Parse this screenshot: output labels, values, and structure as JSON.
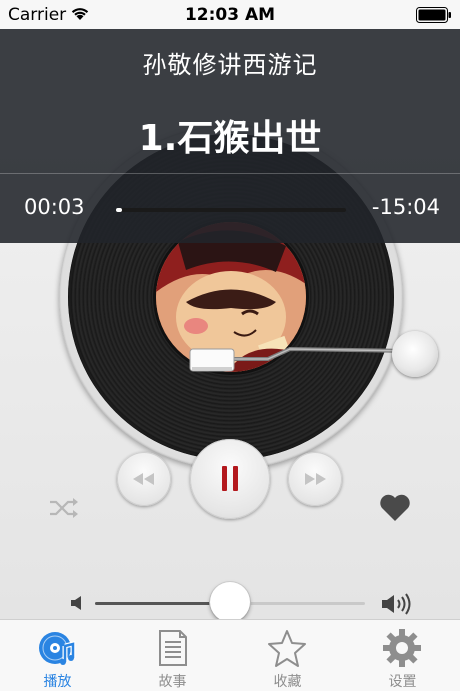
{
  "status_bar": {
    "carrier": "Carrier",
    "time": "12:03 AM"
  },
  "now_playing": {
    "album_title": "孙敬修讲西游记",
    "track_title": "1.石猴出世",
    "elapsed": "00:03",
    "remaining": "-15:04",
    "progress_fraction": 0.01
  },
  "volume": {
    "level_fraction": 0.5
  },
  "tabs": [
    {
      "label": "播放",
      "icon": "play-disc-icon",
      "active": true
    },
    {
      "label": "故事",
      "icon": "document-list-icon",
      "active": false
    },
    {
      "label": "收藏",
      "icon": "star-icon",
      "active": false
    },
    {
      "label": "设置",
      "icon": "gear-icon",
      "active": false
    }
  ],
  "colors": {
    "accent": "#2a84e2",
    "pause_icon": "#b3181d",
    "overlay": "#21242a"
  }
}
